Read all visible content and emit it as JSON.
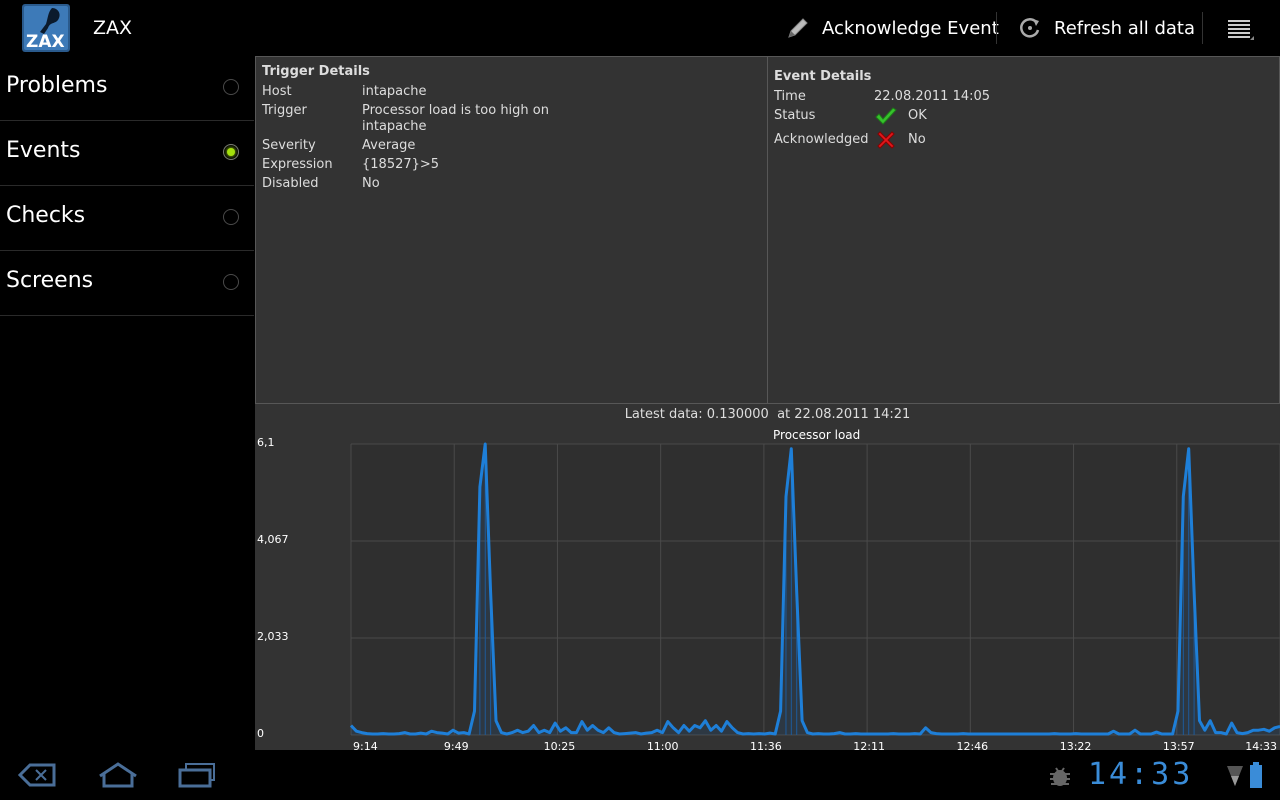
{
  "app": {
    "title": "ZAX",
    "logo_text": "ZAX"
  },
  "actionbar": {
    "acknowledge_label": "Acknowledge Event",
    "refresh_label": "Refresh all data"
  },
  "sidebar": {
    "items": [
      {
        "label": "Problems",
        "selected": false
      },
      {
        "label": "Events",
        "selected": true
      },
      {
        "label": "Checks",
        "selected": false
      },
      {
        "label": "Screens",
        "selected": false
      }
    ]
  },
  "trigger": {
    "heading": "Trigger Details",
    "host_label": "Host",
    "host": "intapache",
    "trigger_label": "Trigger",
    "trigger": "Processor load is too high on intapache",
    "severity_label": "Severity",
    "severity": "Average",
    "expression_label": "Expression",
    "expression": "{18527}>5",
    "disabled_label": "Disabled",
    "disabled": "No"
  },
  "event": {
    "heading": "Event Details",
    "time_label": "Time",
    "time": "22.08.2011 14:05",
    "status_label": "Status",
    "status": "OK",
    "ack_label": "Acknowledged",
    "ack": "No",
    "status_icon": "check-icon",
    "ack_icon": "cross-icon"
  },
  "latest": "Latest data: 0.130000  at 22.08.2011 14:21",
  "chart_data": {
    "type": "line",
    "title": "Processor load",
    "y_ticks": [
      "6,1",
      "4,067",
      "2,033",
      "0"
    ],
    "x_ticks": [
      "9:14",
      "9:49",
      "10:25",
      "11:00",
      "11:36",
      "12:11",
      "12:46",
      "13:22",
      "13:57",
      "14:33"
    ],
    "ylim": [
      0,
      6.1
    ],
    "line_color": "#1e7fd8",
    "series": [
      {
        "values": [
          0.2,
          0.08,
          0.05,
          0.03,
          0.02,
          0.02,
          0.03,
          0.02,
          0.02,
          0.03,
          0.05,
          0.02,
          0.02,
          0.04,
          0.02,
          0.08,
          0.05,
          0.04,
          0.02,
          0.1,
          0.04,
          0.05,
          0.02,
          0.5,
          5.2,
          6.1,
          3.0,
          0.3,
          0.05,
          0.02,
          0.05,
          0.1,
          0.05,
          0.08,
          0.2,
          0.05,
          0.1,
          0.05,
          0.25,
          0.08,
          0.15,
          0.05,
          0.05,
          0.28,
          0.1,
          0.2,
          0.1,
          0.05,
          0.15,
          0.05,
          0.02,
          0.03,
          0.04,
          0.05,
          0.02,
          0.04,
          0.05,
          0.1,
          0.05,
          0.28,
          0.15,
          0.05,
          0.2,
          0.08,
          0.2,
          0.15,
          0.3,
          0.1,
          0.2,
          0.08,
          0.28,
          0.15,
          0.05,
          0.02,
          0.03,
          0.02,
          0.03,
          0.02,
          0.04,
          0.02,
          0.5,
          5.0,
          6.0,
          3.0,
          0.3,
          0.05,
          0.02,
          0.03,
          0.02,
          0.02,
          0.03,
          0.05,
          0.02,
          0.02,
          0.03,
          0.02,
          0.02,
          0.02,
          0.02,
          0.02,
          0.02,
          0.03,
          0.02,
          0.02,
          0.02,
          0.03,
          0.02,
          0.15,
          0.05,
          0.03,
          0.02,
          0.02,
          0.02,
          0.02,
          0.03,
          0.02,
          0.02,
          0.02,
          0.02,
          0.02,
          0.02,
          0.02,
          0.02,
          0.02,
          0.02,
          0.02,
          0.02,
          0.02,
          0.02,
          0.02,
          0.02,
          0.03,
          0.02,
          0.02,
          0.02,
          0.03,
          0.02,
          0.02,
          0.02,
          0.02,
          0.02,
          0.02,
          0.08,
          0.02,
          0.02,
          0.02,
          0.1,
          0.02,
          0.02,
          0.02,
          0.06,
          0.02,
          0.02,
          0.02,
          0.5,
          5.0,
          6.0,
          3.0,
          0.3,
          0.1,
          0.3,
          0.05,
          0.05,
          0.02,
          0.25,
          0.05,
          0.03,
          0.05,
          0.1,
          0.1,
          0.12,
          0.08,
          0.15,
          0.18
        ]
      }
    ]
  },
  "status_bar": {
    "clock": "14:33"
  }
}
